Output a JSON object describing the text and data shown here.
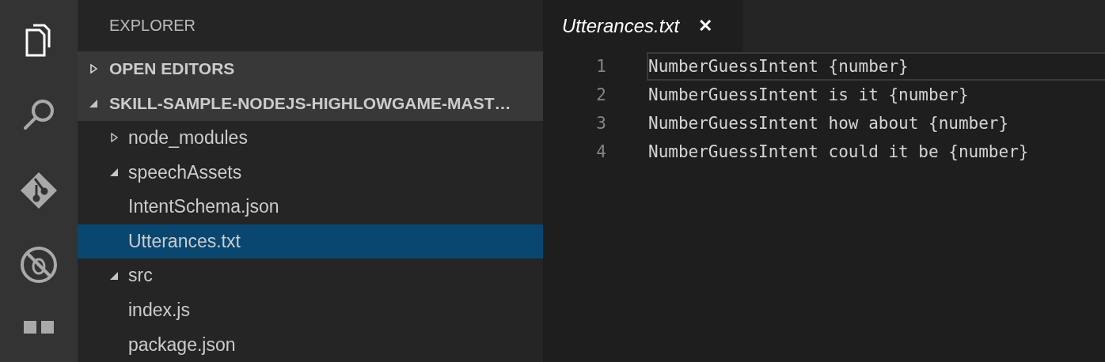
{
  "activity_bar": [
    {
      "kind": "files",
      "selected": true
    },
    {
      "kind": "search",
      "selected": false
    },
    {
      "kind": "git",
      "selected": false
    },
    {
      "kind": "debug",
      "selected": false
    },
    {
      "kind": "extensions",
      "selected": false
    }
  ],
  "sidebar": {
    "title": "EXPLORER",
    "sections": [
      {
        "title": "OPEN EDITORS",
        "expanded": false
      },
      {
        "title": "SKILL-SAMPLE-NODEJS-HIGHLOWGAME-MAST…",
        "expanded": true
      }
    ],
    "tree": [
      {
        "label": "node_modules",
        "expanded": false,
        "selected": false
      },
      {
        "label": "speechAssets",
        "expanded": true,
        "selected": false,
        "children": [
          {
            "label": "IntentSchema.json",
            "selected": false
          },
          {
            "label": "Utterances.txt",
            "selected": true
          }
        ]
      },
      {
        "label": "src",
        "expanded": true,
        "selected": false,
        "children": [
          {
            "label": "index.js",
            "selected": false
          },
          {
            "label": "package.json",
            "selected": false
          }
        ]
      }
    ]
  },
  "tabs": [
    {
      "label": "Utterances.txt",
      "selected": true,
      "close": "✕"
    }
  ],
  "editor": {
    "lines": [
      {
        "number": "1",
        "text": "NumberGuessIntent {number}",
        "current": true
      },
      {
        "number": "2",
        "text": "NumberGuessIntent is it {number}",
        "current": false
      },
      {
        "number": "3",
        "text": "NumberGuessIntent how about {number}",
        "current": false
      },
      {
        "number": "4",
        "text": "NumberGuessIntent could it be {number}",
        "current": false
      }
    ]
  }
}
